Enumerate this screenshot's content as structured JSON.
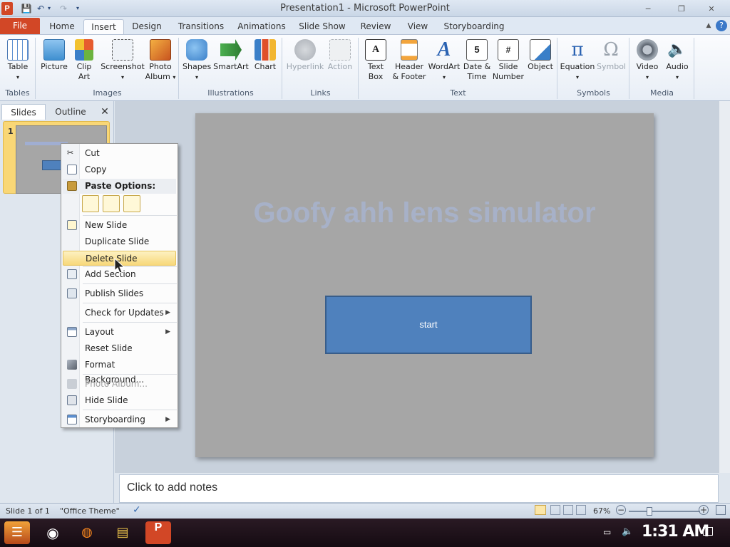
{
  "window": {
    "title": "Presentation1 - Microsoft PowerPoint",
    "app_icon": "P",
    "controls": [
      "minimize",
      "restore",
      "close"
    ]
  },
  "ribbon_tabs": {
    "file": "File",
    "tabs": [
      "Home",
      "Insert",
      "Design",
      "Transitions",
      "Animations",
      "Slide Show",
      "Review",
      "View",
      "Storyboarding"
    ],
    "active": "Insert"
  },
  "ribbon": {
    "groups": [
      {
        "label": "Tables",
        "buttons": [
          {
            "label": "Table",
            "icon": "table-icon"
          }
        ]
      },
      {
        "label": "Images",
        "buttons": [
          {
            "label": "Picture",
            "icon": "picture-icon"
          },
          {
            "label": "Clip Art",
            "icon": "clip-art-icon"
          },
          {
            "label": "Screenshot",
            "icon": "screenshot-icon"
          },
          {
            "label": "Photo Album",
            "icon": "photo-album-icon"
          }
        ]
      },
      {
        "label": "Illustrations",
        "buttons": [
          {
            "label": "Shapes",
            "icon": "shapes-icon"
          },
          {
            "label": "SmartArt",
            "icon": "smartart-icon"
          },
          {
            "label": "Chart",
            "icon": "chart-icon"
          }
        ]
      },
      {
        "label": "Links",
        "buttons": [
          {
            "label": "Hyperlink",
            "icon": "hyperlink-icon",
            "disabled": true
          },
          {
            "label": "Action",
            "icon": "action-icon",
            "disabled": true
          }
        ]
      },
      {
        "label": "Text",
        "buttons": [
          {
            "label": "Text Box",
            "icon": "text-box-icon"
          },
          {
            "label": "Header & Footer",
            "icon": "header-footer-icon"
          },
          {
            "label": "WordArt",
            "icon": "wordart-icon"
          },
          {
            "label": "Date & Time",
            "icon": "date-time-icon"
          },
          {
            "label": "Slide Number",
            "icon": "slide-number-icon"
          },
          {
            "label": "Object",
            "icon": "object-icon"
          }
        ]
      },
      {
        "label": "Symbols",
        "buttons": [
          {
            "label": "Equation",
            "icon": "equation-icon"
          },
          {
            "label": "Symbol",
            "icon": "symbol-icon",
            "disabled": true
          }
        ]
      },
      {
        "label": "Media",
        "buttons": [
          {
            "label": "Video",
            "icon": "video-icon"
          },
          {
            "label": "Audio",
            "icon": "audio-icon"
          }
        ]
      }
    ]
  },
  "left_panel": {
    "tabs": [
      "Slides",
      "Outline"
    ],
    "active_tab": "Slides",
    "close_glyph": "✕",
    "slide_number": "1"
  },
  "slide": {
    "title": "Goofy ahh lens simulator",
    "button_text": "start"
  },
  "notes": {
    "placeholder": "Click to add notes"
  },
  "context_menu": {
    "items": [
      {
        "label": "Cut",
        "icon": "scissors-icon"
      },
      {
        "label": "Copy",
        "icon": "copy-icon"
      },
      {
        "label": "Paste Options:",
        "icon": "paste-icon",
        "header": true
      },
      {
        "label": "New Slide",
        "icon": "new-slide-icon"
      },
      {
        "label": "Duplicate Slide"
      },
      {
        "label": "Delete Slide",
        "hover": true
      },
      {
        "label": "Add Section",
        "icon": "add-section-icon"
      },
      {
        "label": "Publish Slides",
        "icon": "publish-slides-icon"
      },
      {
        "label": "Check for Updates",
        "submenu": true
      },
      {
        "label": "Layout",
        "icon": "layout-icon",
        "submenu": true
      },
      {
        "label": "Reset Slide"
      },
      {
        "label": "Format Background...",
        "icon": "format-background-icon"
      },
      {
        "label": "Photo Album...",
        "icon": "photo-album-icon",
        "disabled": true
      },
      {
        "label": "Hide Slide",
        "icon": "hide-slide-icon"
      },
      {
        "label": "Storyboarding",
        "icon": "storyboarding-icon",
        "submenu": true
      }
    ],
    "paste_options": [
      "use-destination-theme-icon",
      "keep-source-formatting-icon",
      "picture-paste-icon"
    ]
  },
  "status_bar": {
    "slide_info": "Slide 1 of 1",
    "theme": "\"Office Theme\"",
    "zoom": "67%"
  },
  "taskbar": {
    "apps": [
      "start-icon",
      "chrome-icon",
      "firefox-icon",
      "file-explorer-icon",
      "powerpoint-icon"
    ],
    "clock": "1:31 AM"
  },
  "colors": {
    "file_tab": "#d24726",
    "slide_bg": "#a6a6a6",
    "shape_fill": "#4f81bd",
    "menu_hover": "#f7d87a"
  }
}
